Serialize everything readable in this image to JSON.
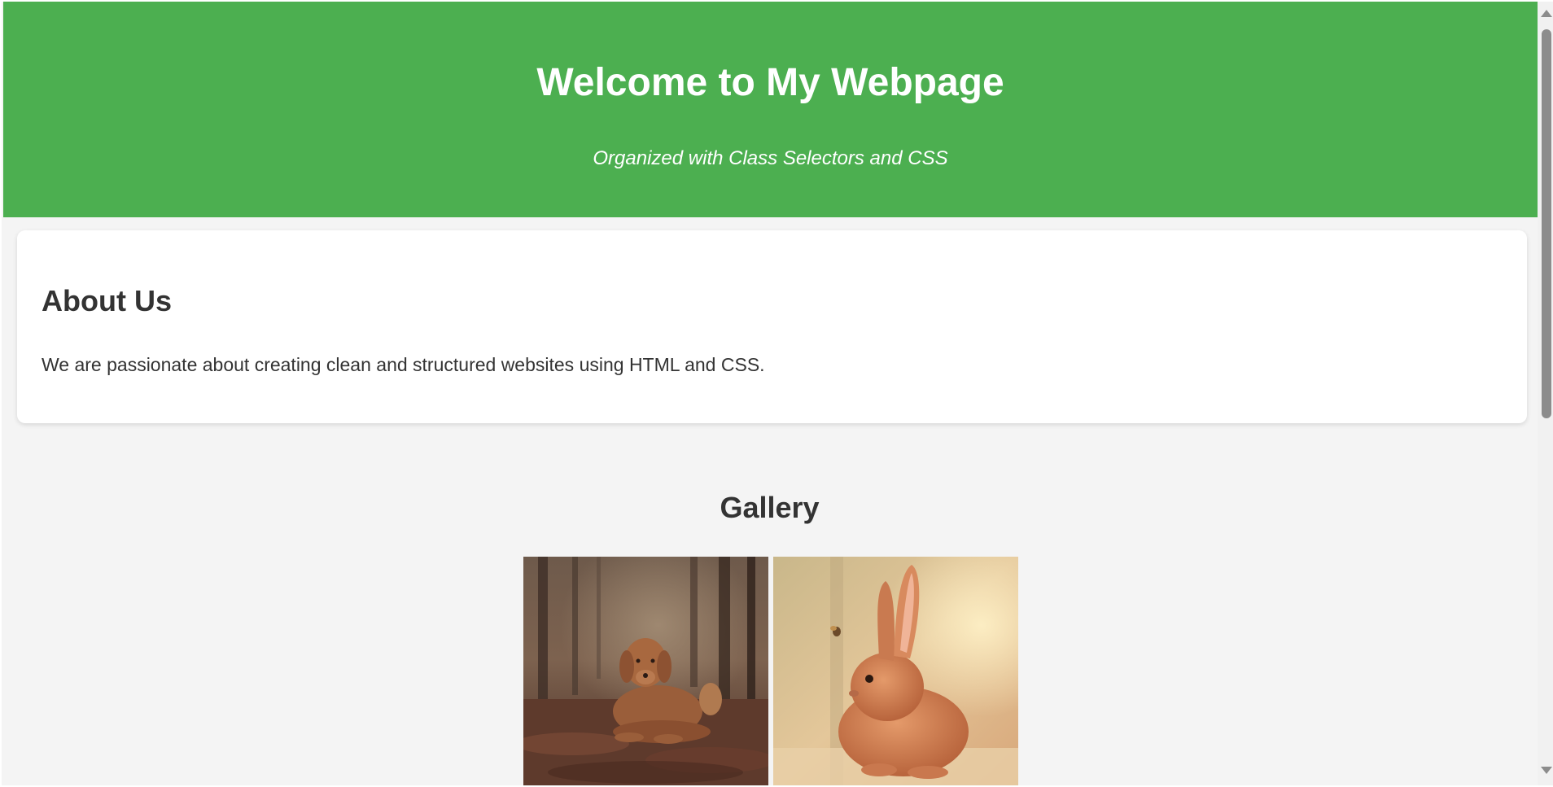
{
  "header": {
    "title": "Welcome to My Webpage",
    "subtitle": "Organized with Class Selectors and CSS",
    "background_color": "#4caf50"
  },
  "about": {
    "heading": "About Us",
    "text": "We are passionate about creating clean and structured websites using HTML and CSS."
  },
  "gallery": {
    "heading": "Gallery",
    "images": [
      {
        "name": "dog-image"
      },
      {
        "name": "rabbit-image"
      }
    ]
  },
  "page": {
    "background_color": "#f4f4f4",
    "text_color": "#333333"
  }
}
